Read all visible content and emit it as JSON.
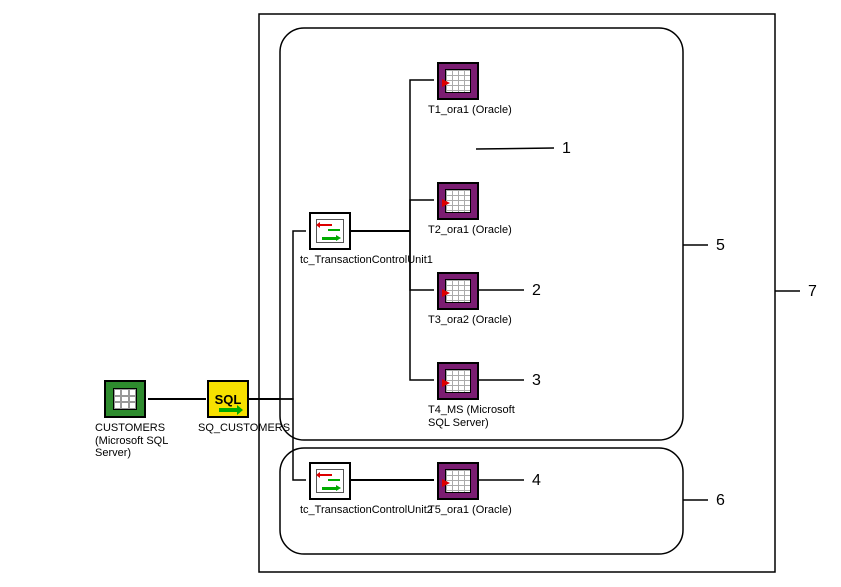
{
  "nodes": {
    "source": {
      "label": "CUSTOMERS (Microsoft SQL Server)"
    },
    "sq": {
      "label": "SQ_CUSTOMERS",
      "icon_text": "SQL"
    },
    "tc1": {
      "label": "tc_TransactionControlUnit1"
    },
    "tc2": {
      "label": "tc_TransactionControlUnit2"
    },
    "t1": {
      "label": "T1_ora1 (Oracle)"
    },
    "t2": {
      "label": "T2_ora1 (Oracle)"
    },
    "t3": {
      "label": "T3_ora2 (Oracle)"
    },
    "t4": {
      "label": "T4_MS (Microsoft SQL Server)"
    },
    "t5": {
      "label": "T5_ora1 (Oracle)"
    }
  },
  "callouts": {
    "c1": "1",
    "c2": "2",
    "c3": "3",
    "c4": "4",
    "c5": "5",
    "c6": "6",
    "c7": "7"
  }
}
